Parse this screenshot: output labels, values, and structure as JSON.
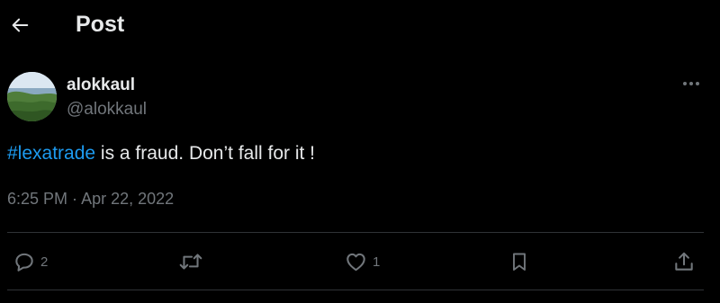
{
  "header": {
    "title": "Post",
    "back_icon": "arrow-left-icon"
  },
  "tweet": {
    "author": {
      "display_name": "alokkaul",
      "handle": "@alokkaul"
    },
    "hashtag": "#lexatrade",
    "text": " is a fraud. Don’t fall for it !",
    "time": "6:25 PM",
    "separator": " · ",
    "date": "Apr 22, 2022"
  },
  "actions": {
    "reply": {
      "icon": "reply-icon",
      "count": "2"
    },
    "repost": {
      "icon": "repost-icon"
    },
    "like": {
      "icon": "heart-icon",
      "count": "1"
    },
    "bookmark": {
      "icon": "bookmark-icon"
    },
    "share": {
      "icon": "share-icon"
    }
  },
  "colors": {
    "background": "#000000",
    "text_primary": "#e7e9ea",
    "text_secondary": "#71767b",
    "accent": "#1d9bf0",
    "divider": "#2f3336"
  }
}
